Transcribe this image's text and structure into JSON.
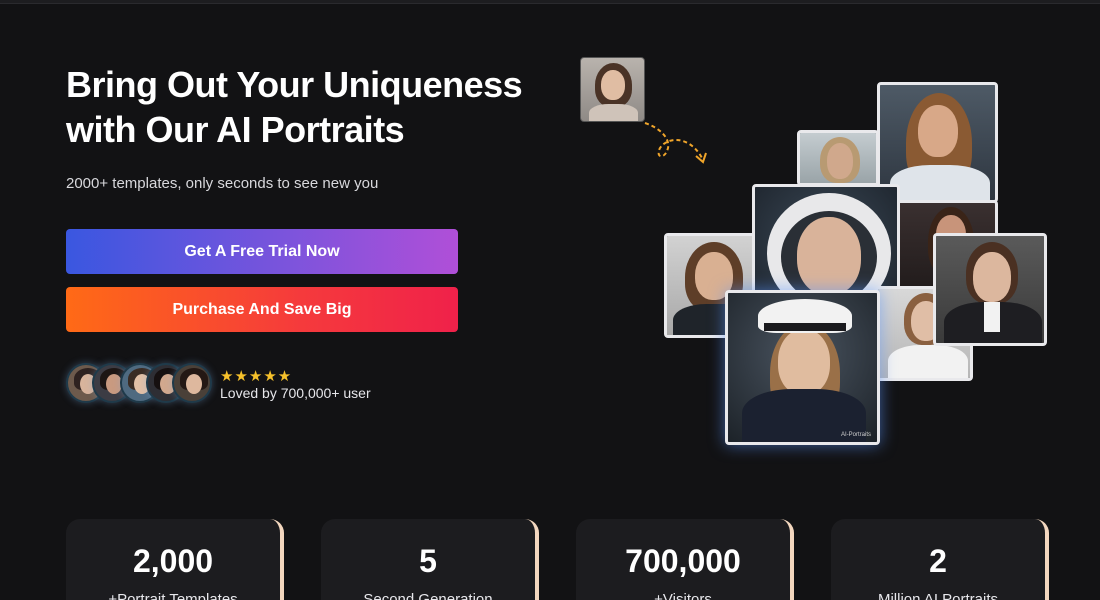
{
  "hero": {
    "title": "Bring Out Your Uniqueness with Our AI Portraits",
    "subtitle": "2000+ templates, only seconds to see new you",
    "trial_button": "Get A Free Trial Now",
    "purchase_button": "Purchase And Save Big"
  },
  "social_proof": {
    "stars": "★★★★★",
    "rating": 5,
    "loved_text": "Loved by 700,000+ user"
  },
  "stats": [
    {
      "number": "2,000",
      "label": "+Portrait Templates"
    },
    {
      "number": "5",
      "label": "Second Generation"
    },
    {
      "number": "700,000",
      "label": "+Visitors"
    },
    {
      "number": "2",
      "label": "Million AI Portraits"
    }
  ],
  "colors": {
    "background": "#121214",
    "trial_gradient_start": "#3a57e0",
    "trial_gradient_end": "#b04fd8",
    "purchase_gradient_start": "#ff6a16",
    "purchase_gradient_end": "#f0214a",
    "star": "#f6c12b",
    "stat_accent": "#f3d7bf"
  },
  "icons": {
    "arrow": "dashed-curved-arrow-icon",
    "star": "star-icon"
  },
  "portrait_watermark": "AI-Portraits"
}
